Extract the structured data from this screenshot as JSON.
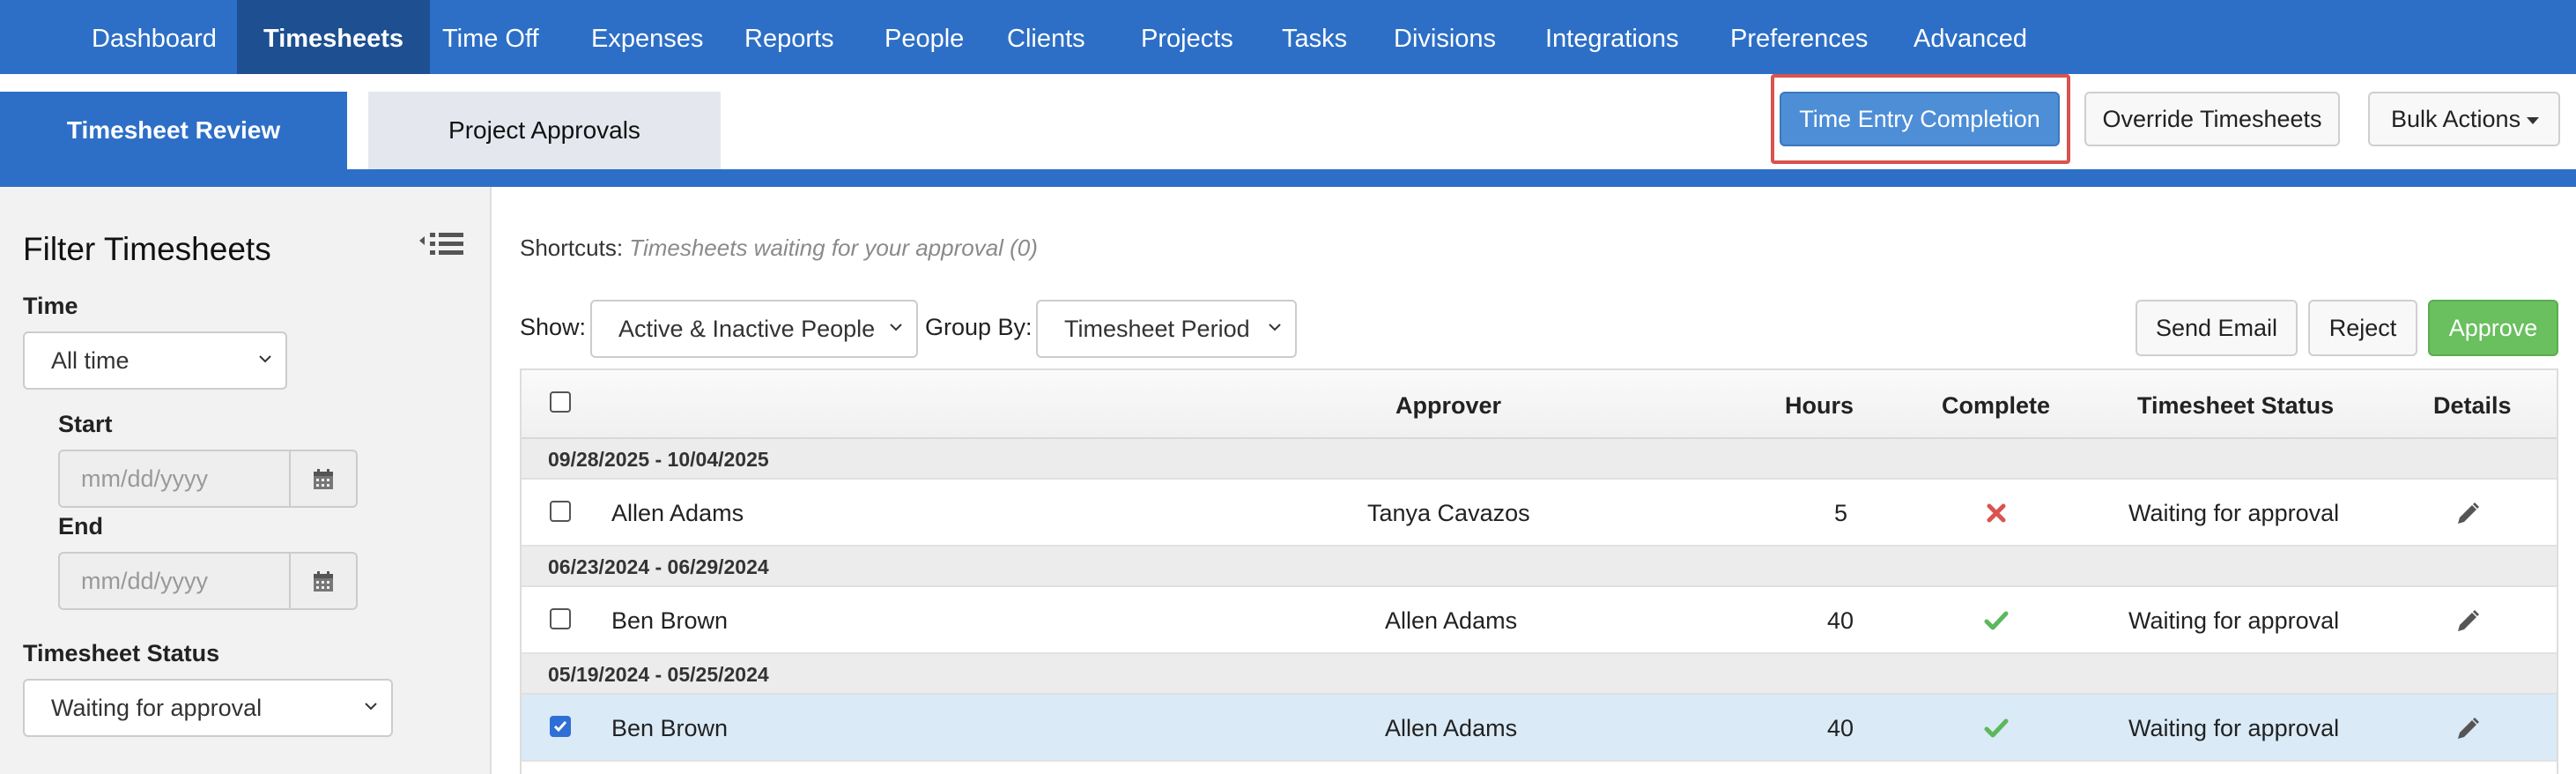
{
  "nav": {
    "items": [
      {
        "label": "Dashboard",
        "active": false
      },
      {
        "label": "Timesheets",
        "active": true
      },
      {
        "label": "Time Off",
        "active": false
      },
      {
        "label": "Expenses",
        "active": false
      },
      {
        "label": "Reports",
        "active": false
      },
      {
        "label": "People",
        "active": false
      },
      {
        "label": "Clients",
        "active": false
      },
      {
        "label": "Projects",
        "active": false
      },
      {
        "label": "Tasks",
        "active": false
      },
      {
        "label": "Divisions",
        "active": false
      },
      {
        "label": "Integrations",
        "active": false
      },
      {
        "label": "Preferences",
        "active": false
      },
      {
        "label": "Advanced",
        "active": false
      }
    ]
  },
  "tabs": {
    "review": "Timesheet Review",
    "approvals": "Project Approvals"
  },
  "actions": {
    "time_entry_completion": "Time Entry Completion",
    "override_timesheets": "Override Timesheets",
    "bulk_actions": "Bulk Actions"
  },
  "sidebar": {
    "title": "Filter Timesheets",
    "time_label": "Time",
    "time_value": "All time",
    "start_label": "Start",
    "start_placeholder": "mm/dd/yyyy",
    "end_label": "End",
    "end_placeholder": "mm/dd/yyyy",
    "status_label": "Timesheet Status",
    "status_value": "Waiting for approval"
  },
  "main": {
    "shortcuts_label": "Shortcuts:",
    "shortcuts_link": "Timesheets waiting for your approval (0)",
    "show_label": "Show:",
    "show_value": "Active & Inactive People",
    "group_label": "Group By:",
    "group_value": "Timesheet Period",
    "send_email": "Send Email",
    "reject": "Reject",
    "approve": "Approve"
  },
  "table": {
    "columns": {
      "approver": "Approver",
      "hours": "Hours",
      "complete": "Complete",
      "status": "Timesheet Status",
      "details": "Details"
    },
    "groups": [
      {
        "period": "09/28/2025 - 10/04/2025",
        "rows": [
          {
            "name": "Allen Adams",
            "approver": "Tanya Cavazos",
            "hours": "5",
            "complete": false,
            "status": "Waiting for approval",
            "checked": false
          }
        ]
      },
      {
        "period": "06/23/2024 - 06/29/2024",
        "rows": [
          {
            "name": "Ben Brown",
            "approver": "Allen Adams",
            "hours": "40",
            "complete": true,
            "status": "Waiting for approval",
            "checked": false
          }
        ]
      },
      {
        "period": "05/19/2024 - 05/25/2024",
        "rows": [
          {
            "name": "Ben Brown",
            "approver": "Allen Adams",
            "hours": "40",
            "complete": true,
            "status": "Waiting for approval",
            "checked": true
          }
        ]
      }
    ]
  },
  "colors": {
    "nav_bg": "#2d6fc6",
    "nav_active": "#1d4f91",
    "approve_green": "#6abf5f",
    "reject_red": "#d9534f",
    "check_green": "#5cb85c"
  }
}
